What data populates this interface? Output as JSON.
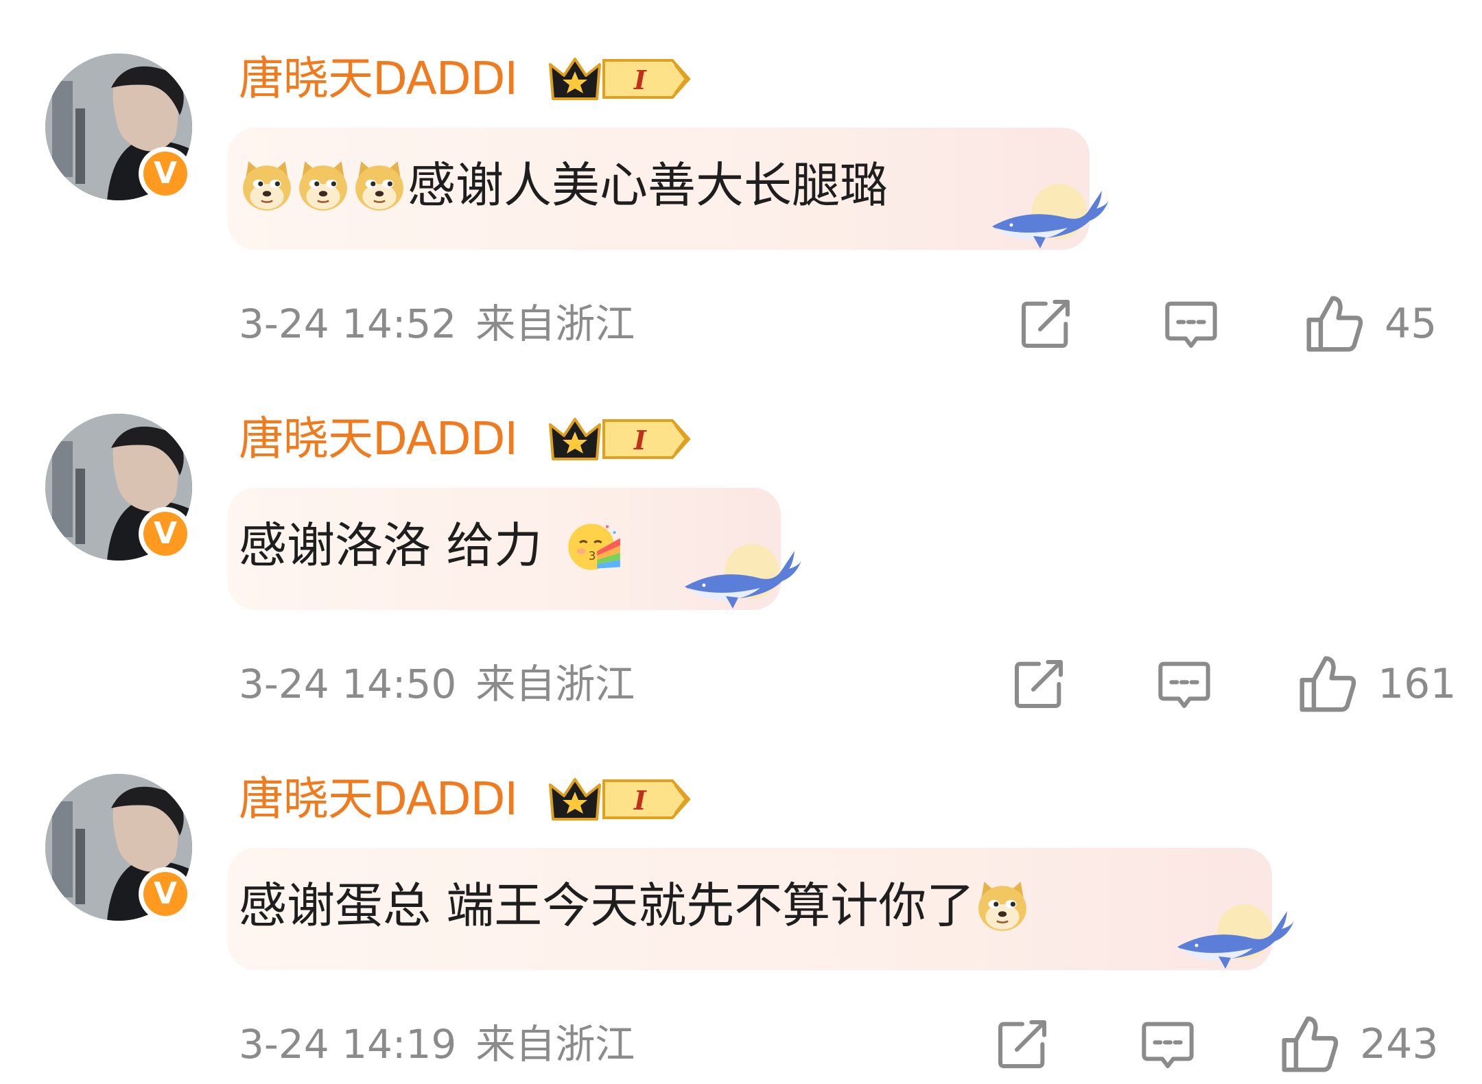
{
  "comments": [
    {
      "username": "唐晓天DADDI",
      "vip_level": "I",
      "verified_mark": "V",
      "emoji_prefix": [
        "doge",
        "doge",
        "doge"
      ],
      "text": "感谢人美心善大长腿璐",
      "emoji_suffix": [],
      "time": "3-24 14:52",
      "location": "来自浙江",
      "likes": "45"
    },
    {
      "username": "唐晓天DADDI",
      "vip_level": "I",
      "verified_mark": "V",
      "emoji_prefix": [],
      "text": "感谢洛洛 给力",
      "emoji_suffix": [
        "rainbow-face"
      ],
      "time": "3-24 14:50",
      "location": "来自浙江",
      "likes": "161"
    },
    {
      "username": "唐晓天DADDI",
      "vip_level": "I",
      "verified_mark": "V",
      "emoji_prefix": [],
      "text": "感谢蛋总 端王今天就先不算计你了",
      "emoji_suffix": [
        "doge"
      ],
      "time": "3-24 14:19",
      "location": "来自浙江",
      "likes": "243"
    }
  ],
  "icons": {
    "share": "share-icon",
    "reply": "comment-icon",
    "like": "thumbs-up-icon"
  },
  "colors": {
    "username": "#f07a1c",
    "meta": "#8b8b8b",
    "text": "#1e1e1e",
    "bubble": "#fdeee8",
    "verified": "#ff9a1f",
    "whale": "#5b7fd8"
  }
}
